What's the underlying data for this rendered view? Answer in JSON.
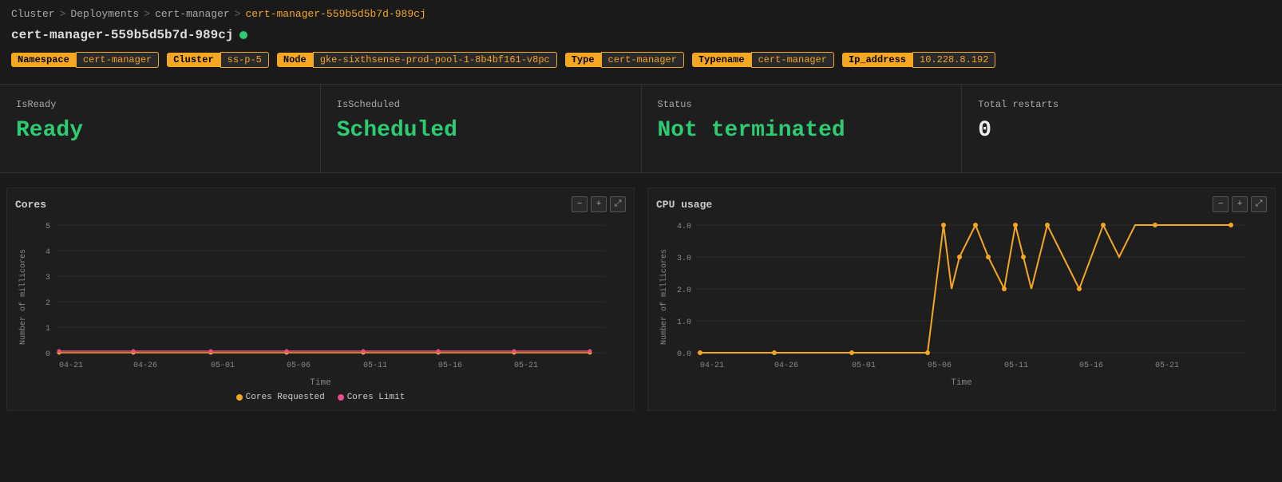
{
  "breadcrumb": {
    "items": [
      "Cluster",
      "Deployments",
      "cert-manager"
    ],
    "active": "cert-manager-559b5d5b7d-989cj",
    "separators": [
      ">",
      ">",
      ">"
    ]
  },
  "page": {
    "title": "cert-manager-559b5d5b7d-989cj",
    "status_dot_color": "#2ecc71"
  },
  "tags": [
    {
      "label": "Namespace",
      "value": "cert-manager"
    },
    {
      "label": "Cluster",
      "value": "ss-p-5"
    },
    {
      "label": "Node",
      "value": "gke-sixthsense-prod-pool-1-8b4bf161-v8pc"
    },
    {
      "label": "Type",
      "value": "cert-manager"
    },
    {
      "label": "Typename",
      "value": "cert-manager"
    },
    {
      "label": "Ip_address",
      "value": "10.228.8.192"
    }
  ],
  "cards": [
    {
      "label": "IsReady",
      "value": "Ready",
      "color": "green"
    },
    {
      "label": "IsScheduled",
      "value": "Scheduled",
      "color": "green"
    },
    {
      "label": "Status",
      "value": "Not terminated",
      "color": "green"
    },
    {
      "label": "Total restarts",
      "value": "0",
      "color": "white"
    }
  ],
  "charts": [
    {
      "title": "Cores",
      "y_label": "Number of millicores",
      "x_label": "Time",
      "controls": [
        "-",
        "+",
        "⤢"
      ],
      "legend": [
        {
          "label": "Cores Requested",
          "color": "#f5a623"
        },
        {
          "label": "Cores Limit",
          "color": "#e74c8b"
        }
      ],
      "x_ticks": [
        "04-21",
        "04-26",
        "05-01",
        "05-06",
        "05-11",
        "05-16",
        "05-21"
      ],
      "y_ticks": [
        "0",
        "1",
        "2",
        "3",
        "4",
        "5"
      ]
    },
    {
      "title": "CPU usage",
      "y_label": "Number of millicores",
      "x_label": "Time",
      "controls": [
        "-",
        "+",
        "⤢"
      ],
      "legend": [],
      "x_ticks": [
        "04-21",
        "04-26",
        "05-01",
        "05-06",
        "05-11",
        "05-16",
        "05-21"
      ],
      "y_ticks": [
        "0.0",
        "1.0",
        "2.0",
        "3.0",
        "4.0"
      ]
    }
  ]
}
